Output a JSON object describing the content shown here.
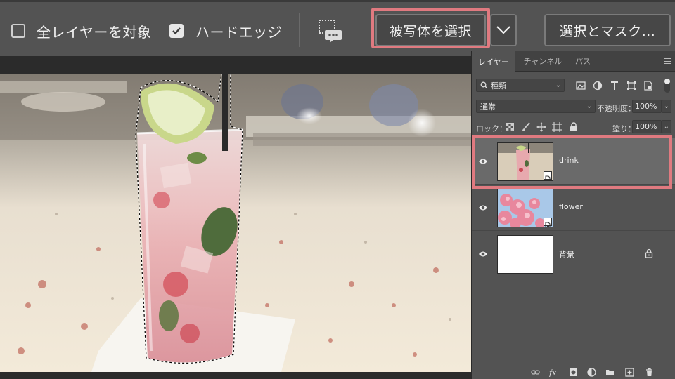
{
  "options_bar": {
    "all_layers_label": "全レイヤーを対象",
    "all_layers_checked": false,
    "hard_edge_label": "ハードエッジ",
    "hard_edge_checked": true,
    "select_subject_label": "被写体を選択",
    "select_and_mask_label": "選択とマスク..."
  },
  "panel": {
    "tabs": [
      {
        "label": "レイヤー",
        "active": true
      },
      {
        "label": "チャンネル",
        "active": false
      },
      {
        "label": "パス",
        "active": false
      }
    ],
    "filter_label": "種類",
    "blend_mode": "通常",
    "opacity_label": "不透明度：",
    "opacity_value": "100%",
    "lock_label": "ロック：",
    "fill_label": "塗り：",
    "fill_value": "100%",
    "layers": [
      {
        "name": "drink",
        "selected": true,
        "smart_object": true,
        "locked": false
      },
      {
        "name": "flower",
        "selected": false,
        "smart_object": true,
        "locked": false
      },
      {
        "name": "背景",
        "selected": false,
        "smart_object": false,
        "locked": true
      }
    ]
  },
  "colors": {
    "highlight": "#e07a80",
    "panel_bg": "#535353",
    "selected_layer": "#6a6a6a"
  }
}
